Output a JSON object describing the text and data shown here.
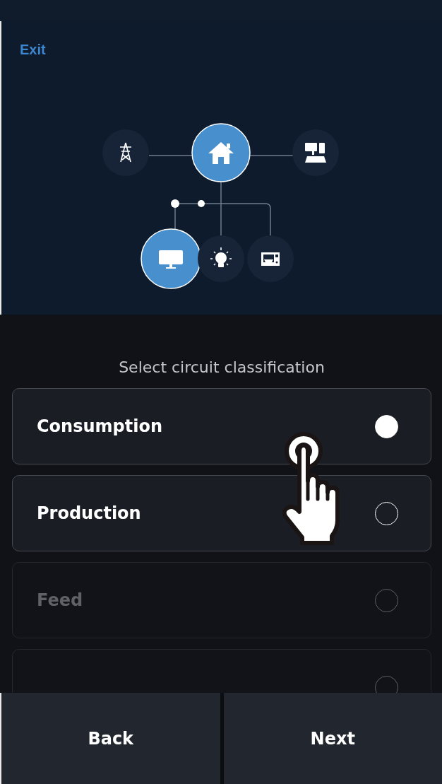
{
  "header": {
    "exit_label": "Exit"
  },
  "diagram": {
    "nodes": [
      {
        "kind": "grid",
        "selected": false
      },
      {
        "kind": "home",
        "selected": true
      },
      {
        "kind": "solar",
        "selected": false
      },
      {
        "kind": "device",
        "selected": true
      },
      {
        "kind": "light",
        "selected": false
      },
      {
        "kind": "appliance",
        "selected": false
      }
    ]
  },
  "prompt": "Select circuit classification",
  "options": [
    {
      "label": "Consumption",
      "selected": true,
      "disabled": false
    },
    {
      "label": "Production",
      "selected": false,
      "disabled": false
    },
    {
      "label": "Feed",
      "selected": false,
      "disabled": true
    },
    {
      "selected": false,
      "disabled": true
    }
  ],
  "buttons": [
    {
      "label": "Back"
    },
    {
      "label": "Next"
    }
  ]
}
